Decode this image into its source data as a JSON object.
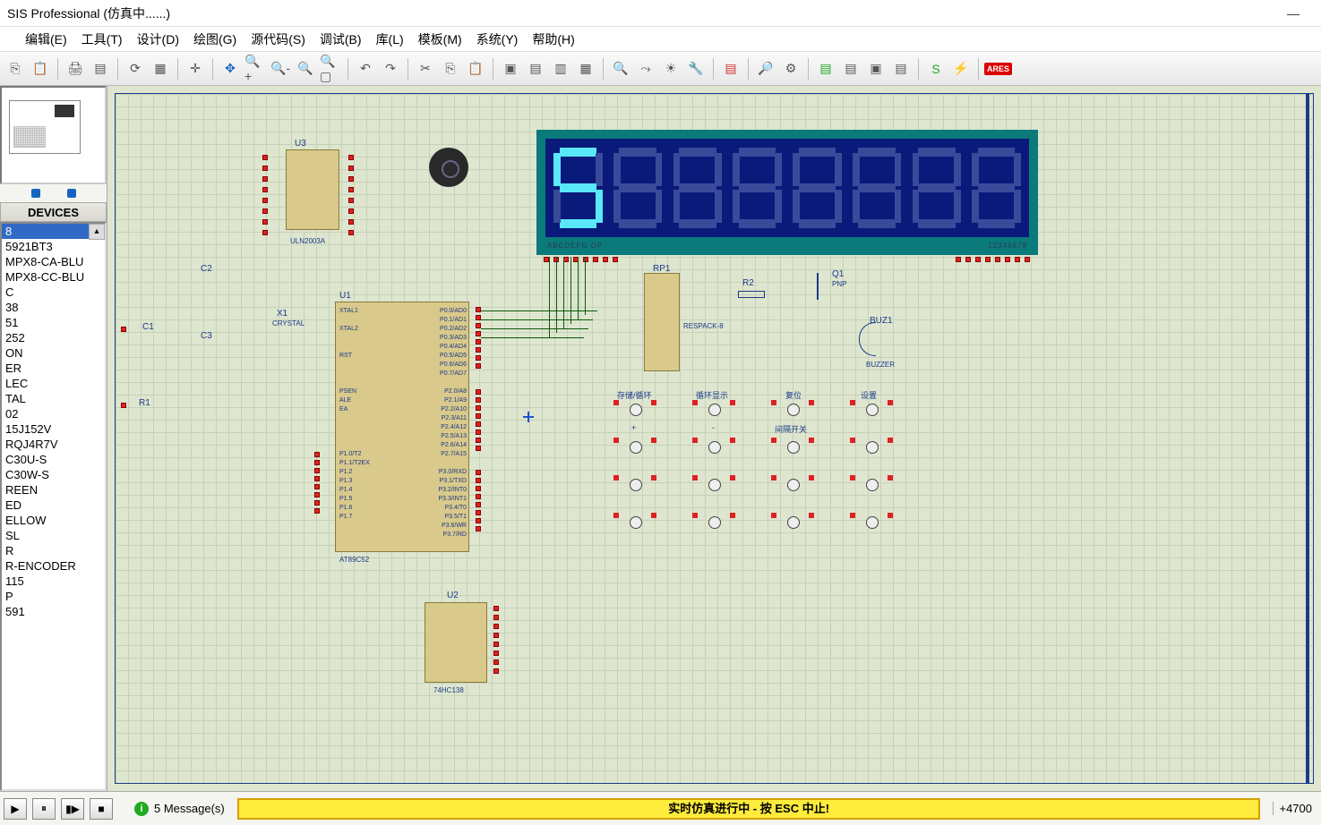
{
  "title": "SIS Professional (仿真中......)",
  "menu": [
    "编辑(E)",
    "工具(T)",
    "设计(D)",
    "绘图(G)",
    "源代码(S)",
    "调试(B)",
    "库(L)",
    "模板(M)",
    "系统(Y)",
    "帮助(H)"
  ],
  "devices_header": "DEVICES",
  "devices": [
    "8",
    "5921BT3",
    "MPX8-CA-BLU",
    "MPX8-CC-BLU",
    "C",
    "38",
    "51",
    "252",
    "ON",
    "ER",
    "",
    "LEC",
    "TAL",
    "02",
    "15J152V",
    "RQJ4R7V",
    "C30U-S",
    "C30W-S",
    "REEN",
    "ED",
    "ELLOW",
    "SL",
    "R",
    "R-ENCODER",
    "115",
    "P",
    "591"
  ],
  "status": {
    "messages": "5 Message(s)",
    "banner": "实时仿真进行中 - 按 ESC 中止!",
    "coord": "+4700"
  },
  "labels": {
    "u1": "U1",
    "u2": "U2",
    "u3": "U3",
    "c1": "C1",
    "c2": "C2",
    "c3": "C3",
    "r1": "R1",
    "r2": "R2",
    "x1": "X1",
    "q1": "Q1",
    "rp1": "RP1",
    "buz1": "BUZ1",
    "crystal": "CRYSTAL",
    "respack": "RESPACK-8",
    "buzzer": "BUZZER",
    "pnp": "PNP",
    "u3type": "ULN2003A",
    "u1type": "AT89C52",
    "u2type": "74HC138",
    "disp_l": "ABCDEFG DP",
    "disp_r": "12345678",
    "btn_labels": [
      "存储/循环",
      "循环显示",
      "复位",
      "设置",
      "+",
      "-",
      "间隔开关"
    ]
  },
  "u1_pins_right": [
    "P0.0/AD0",
    "P0.1/AD1",
    "P0.2/AD2",
    "P0.3/AD3",
    "P0.4/AD4",
    "P0.5/AD5",
    "P0.6/AD6",
    "P0.7/AD7",
    "",
    "P2.0/A8",
    "P2.1/A9",
    "P2.2/A10",
    "P2.3/A11",
    "P2.4/A12",
    "P2.5/A13",
    "P2.6/A14",
    "P2.7/A15",
    "",
    "P3.0/RXD",
    "P3.1/TXD",
    "P3.2/INT0",
    "P3.3/INT1",
    "P3.4/T0",
    "P3.5/T1",
    "P3.6/WR",
    "P3.7/RD"
  ],
  "u1_pins_left": [
    "XTAL1",
    "",
    "XTAL2",
    "",
    "",
    "RST",
    "",
    "",
    "",
    "PSEN",
    "ALE",
    "EA",
    "",
    "",
    "",
    "",
    "P1.0/T2",
    "P1.1/T2EX",
    "P1.2",
    "P1.3",
    "P1.4",
    "P1.5",
    "P1.6",
    "P1.7"
  ],
  "display_digits": [
    {
      "a": 1,
      "b": 0,
      "c": 1,
      "d": 1,
      "e": 0,
      "f": 1,
      "g": 1
    },
    {
      "a": 0,
      "b": 0,
      "c": 0,
      "d": 0,
      "e": 0,
      "f": 0,
      "g": 0
    },
    {
      "a": 0,
      "b": 0,
      "c": 0,
      "d": 0,
      "e": 0,
      "f": 0,
      "g": 0
    },
    {
      "a": 0,
      "b": 0,
      "c": 0,
      "d": 0,
      "e": 0,
      "f": 0,
      "g": 0
    },
    {
      "a": 0,
      "b": 0,
      "c": 0,
      "d": 0,
      "e": 0,
      "f": 0,
      "g": 0
    },
    {
      "a": 0,
      "b": 0,
      "c": 0,
      "d": 0,
      "e": 0,
      "f": 0,
      "g": 0
    },
    {
      "a": 0,
      "b": 0,
      "c": 0,
      "d": 0,
      "e": 0,
      "f": 0,
      "g": 0
    },
    {
      "a": 0,
      "b": 0,
      "c": 0,
      "d": 0,
      "e": 0,
      "f": 0,
      "g": 0
    }
  ]
}
